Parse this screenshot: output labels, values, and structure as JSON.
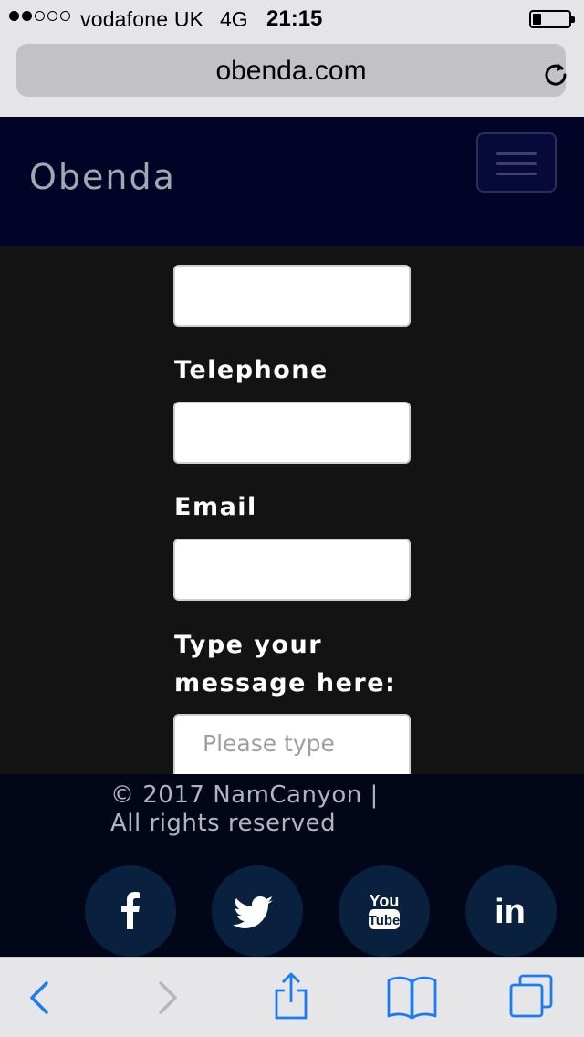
{
  "status_bar": {
    "signal_filled": 2,
    "signal_total": 5,
    "carrier": "vodafone UK",
    "network": "4G",
    "time": "21:15",
    "battery_level_percent": 20
  },
  "browser": {
    "url": "obenda.com",
    "reload_icon": "reload-icon"
  },
  "header": {
    "brand": "Obenda",
    "menu_icon": "hamburger-icon"
  },
  "form": {
    "telephone_label": "Telephone",
    "email_label": "Email",
    "message_label_line1": "Type your",
    "message_label_line2": "message here:",
    "message_placeholder": "Please type"
  },
  "footer": {
    "copyright_line1": "© 2017 NamCanyon |",
    "copyright_line2": "All rights reserved",
    "social": [
      {
        "name": "facebook-icon"
      },
      {
        "name": "twitter-icon"
      },
      {
        "name": "youtube-icon",
        "text_top": "You",
        "text_bottom": "Tube"
      },
      {
        "name": "linkedin-icon",
        "text": "in"
      }
    ]
  },
  "toolbar": {
    "items": [
      "back-icon",
      "forward-icon",
      "share-icon",
      "bookmarks-icon",
      "tabs-icon"
    ]
  },
  "colors": {
    "header_bg": "#020427",
    "form_bg": "#131313",
    "footer_bg": "#020619",
    "social_circle": "#09213f",
    "ios_blue": "#1a7cf5"
  }
}
